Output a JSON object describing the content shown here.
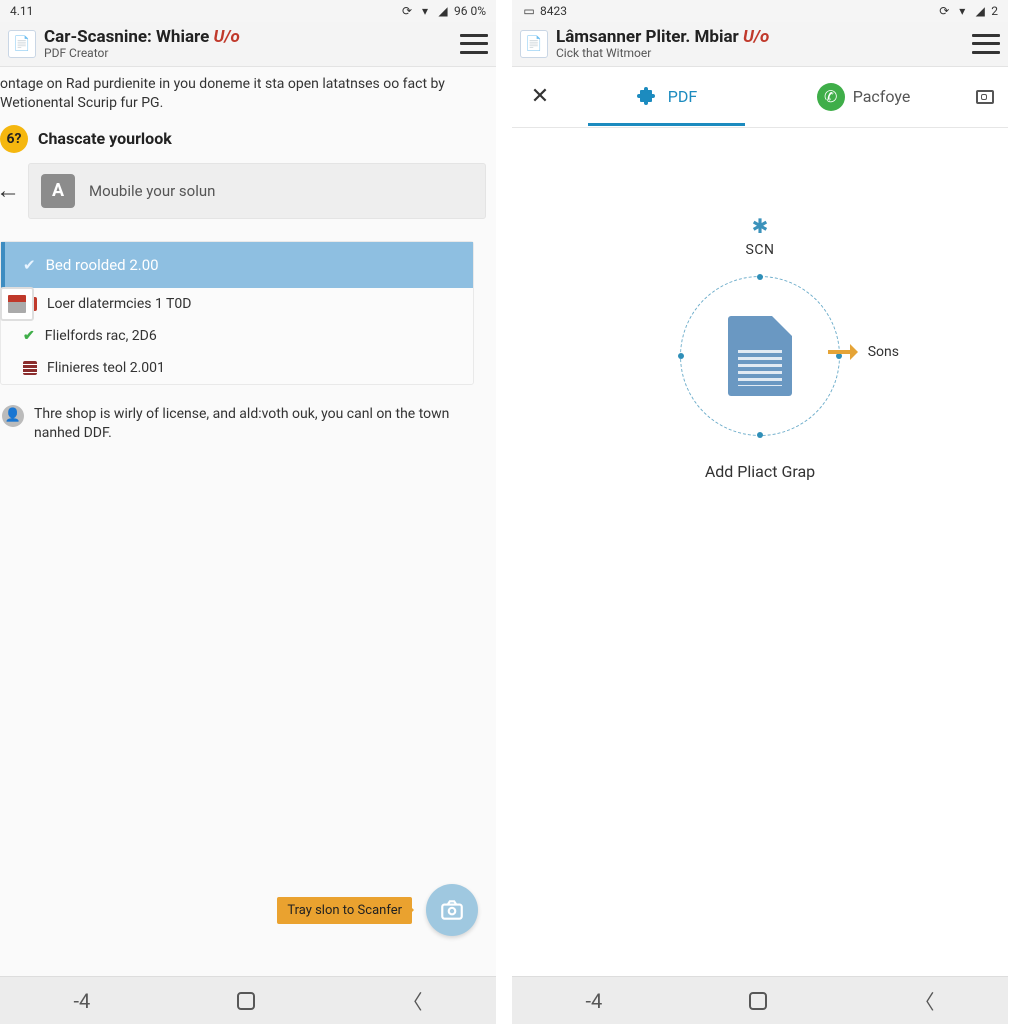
{
  "left": {
    "status": {
      "time": "4.11",
      "battery": "96 0%"
    },
    "header": {
      "title_a": "Car-Scasnine: Whiare",
      "title_accent": "U/o",
      "subtitle": "PDF Creator"
    },
    "intro": "ontage on Rad purdienite in you doneme it sta open latatnses oo fact by Wetionental Scurip fur PG.",
    "badge": {
      "num": "6?",
      "text": "Chascate yourlook"
    },
    "input_placeholder": "Moubile your solun",
    "list": {
      "selected": "Bed roolded 2.00",
      "items": [
        {
          "icon": "red",
          "text": "Loer dlatermcies 1 T0D"
        },
        {
          "icon": "check",
          "text": "Flielfords rac, 2D6"
        },
        {
          "icon": "grid",
          "text": "Flinieres teol 2.001"
        }
      ]
    },
    "footnote": "Thre shop is wirly of license, and ald:voth ouk, you canl on the town nanhed DDF.",
    "fab_label": "Tray slon to Scanfer",
    "nav_back": "-4"
  },
  "right": {
    "status": {
      "time": "8423",
      "battery": "2"
    },
    "header": {
      "title_a": "Lâmsanner Pliter. Mbiar",
      "title_accent": "U/o",
      "subtitle": "Cick that Witmoer"
    },
    "tabs": {
      "pdf": "PDF",
      "pacfoye": "Pacfoye"
    },
    "scn_label": "SCN",
    "arrow_label": "Sons",
    "caption": "Add Pliact Grap",
    "nav_back": "-4"
  }
}
